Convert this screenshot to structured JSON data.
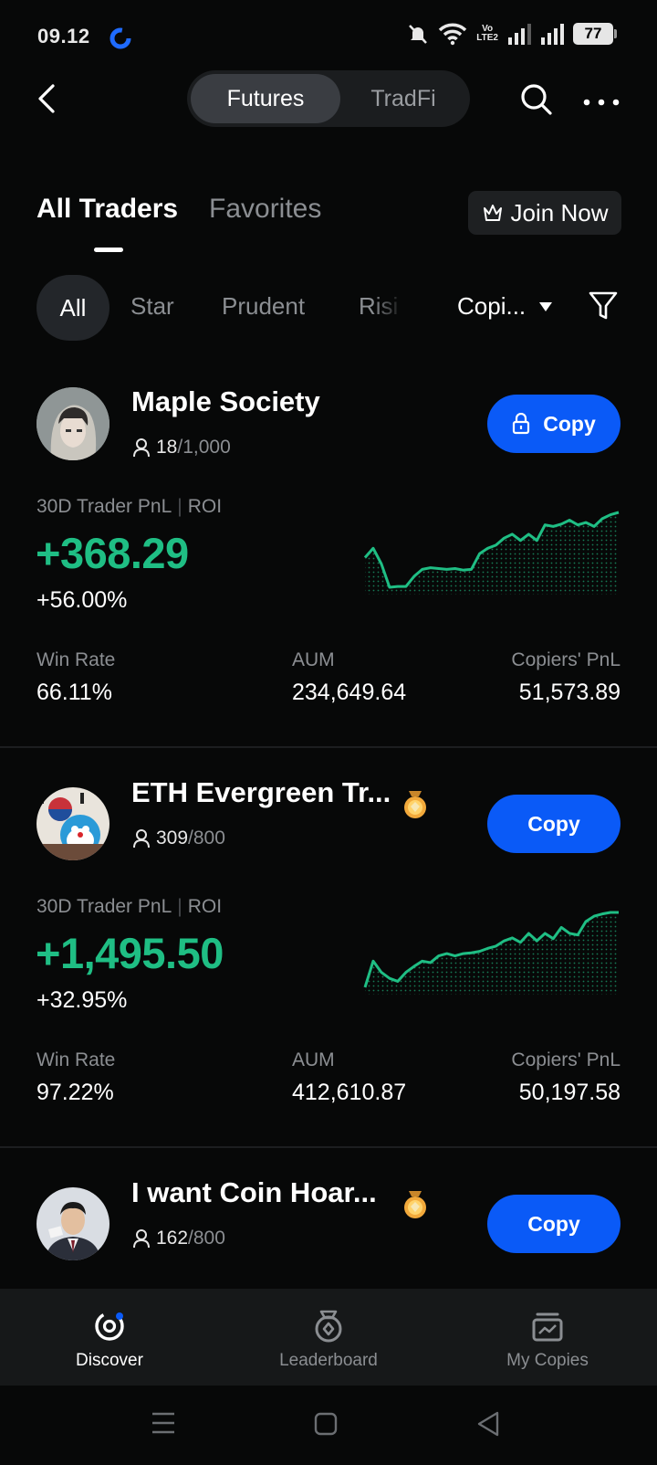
{
  "status_bar": {
    "time": "09.12",
    "battery": "77",
    "volte": [
      "Vo",
      "LTE2"
    ]
  },
  "top_nav": {
    "tabs": [
      {
        "label": "Futures",
        "active": true
      },
      {
        "label": "TradFi",
        "active": false
      }
    ]
  },
  "trader_tabs": {
    "all": "All Traders",
    "favorites": "Favorites",
    "join": "Join Now"
  },
  "filters": {
    "chips": [
      "All",
      "Star",
      "Prudent",
      "Risi"
    ],
    "sort": "Copi..."
  },
  "traders": [
    {
      "name": "Maple Society",
      "copiers": "18",
      "max_copiers": "/1,000",
      "copy_label": "Copy",
      "locked": true,
      "pnl_label": "30D Trader PnL",
      "roi_label": "ROI",
      "pnl": "+368.29",
      "roi": "+56.00%",
      "win_rate_label": "Win Rate",
      "win_rate": "66.11%",
      "aum_label": "AUM",
      "aum": "234,649.64",
      "copiers_pnl_label": "Copiers' PnL",
      "copiers_pnl": "51,573.89",
      "sparkline": [
        0.5,
        0.62,
        0.42,
        0.12,
        0.13,
        0.13,
        0.26,
        0.35,
        0.37,
        0.36,
        0.35,
        0.36,
        0.34,
        0.35,
        0.55,
        0.62,
        0.66,
        0.75,
        0.8,
        0.72,
        0.8,
        0.72,
        0.92,
        0.9,
        0.93,
        0.98,
        0.92,
        0.95,
        0.9,
        1.0,
        1.05,
        1.08
      ]
    },
    {
      "name": "ETH Evergreen Tr...",
      "copiers": "309",
      "max_copiers": "/800",
      "copy_label": "Copy",
      "locked": false,
      "medal": "gold-medal",
      "pnl_label": "30D Trader PnL",
      "roi_label": "ROI",
      "pnl": "+1,495.50",
      "roi": "+32.95%",
      "win_rate_label": "Win Rate",
      "win_rate": "97.22%",
      "aum_label": "AUM",
      "aum": "412,610.87",
      "copiers_pnl_label": "Copiers' PnL",
      "copiers_pnl": "50,197.58",
      "sparkline": [
        0.0,
        0.35,
        0.2,
        0.12,
        0.08,
        0.2,
        0.28,
        0.35,
        0.33,
        0.42,
        0.45,
        0.42,
        0.45,
        0.46,
        0.48,
        0.52,
        0.55,
        0.62,
        0.66,
        0.6,
        0.72,
        0.62,
        0.72,
        0.65,
        0.8,
        0.72,
        0.7,
        0.88,
        0.95,
        0.98,
        1.0,
        1.0
      ]
    },
    {
      "name": "I want Coin Hoar...",
      "copiers": "162",
      "max_copiers": "/800",
      "copy_label": "Copy",
      "locked": false,
      "medal": "gold-medal"
    }
  ],
  "bottom_nav": [
    {
      "label": "Discover",
      "icon": "discover-icon",
      "active": true
    },
    {
      "label": "Leaderboard",
      "icon": "leaderboard-icon",
      "active": false
    },
    {
      "label": "My Copies",
      "icon": "my-copies-icon",
      "active": false
    }
  ],
  "colors": {
    "accent": "#0a5af7",
    "positive": "#1fbe84",
    "background": "#070808"
  }
}
